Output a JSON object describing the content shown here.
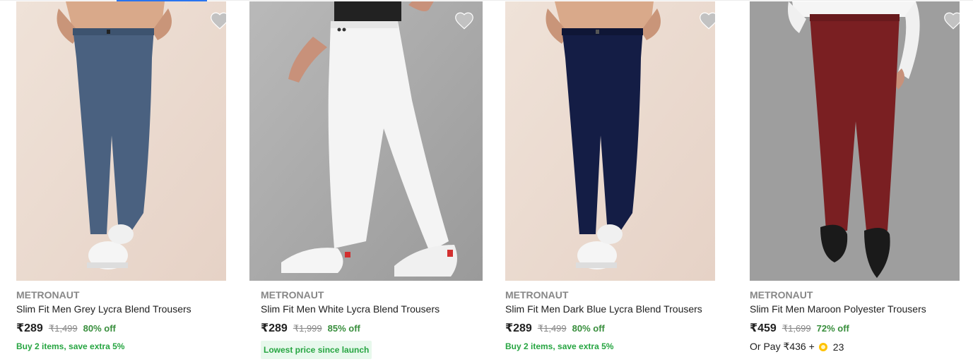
{
  "colors": {
    "accent": "#2874f0",
    "discount_green": "#388e3c",
    "offer_green": "#26a541",
    "muted_gray": "#878787",
    "wishlist_heart": "#c2c2c2"
  },
  "products": [
    {
      "brand": "METRONAUT",
      "title": "Slim Fit Men Grey Lycra Blend Trousers",
      "price": "₹289",
      "mrp": "₹1,499",
      "discount": "80% off",
      "offer": "Buy 2 items, save extra 5%",
      "image_icon": "grey-trousers-photo",
      "trouser_color": "#4a6180"
    },
    {
      "brand": "METRONAUT",
      "title": "Slim Fit Men White Lycra Blend Trousers",
      "price": "₹289",
      "mrp": "₹1,999",
      "discount": "85% off",
      "badge": "Lowest price since launch",
      "image_icon": "white-trousers-photo",
      "trouser_color": "#f4f4f4"
    },
    {
      "brand": "METRONAUT",
      "title": "Slim Fit Men Dark Blue Lycra Blend Trousers",
      "price": "₹289",
      "mrp": "₹1,499",
      "discount": "80% off",
      "offer": "Buy 2 items, save extra 5%",
      "image_icon": "dark-blue-trousers-photo",
      "trouser_color": "#141d45"
    },
    {
      "brand": "METRONAUT",
      "title": "Slim Fit Men Maroon Polyester Trousers",
      "price": "₹459",
      "mrp": "₹1,699",
      "discount": "72% off",
      "pay_prefix": "Or Pay ₹436 +",
      "coins": "23",
      "image_icon": "maroon-trousers-photo",
      "trouser_color": "#7a1f22"
    }
  ]
}
